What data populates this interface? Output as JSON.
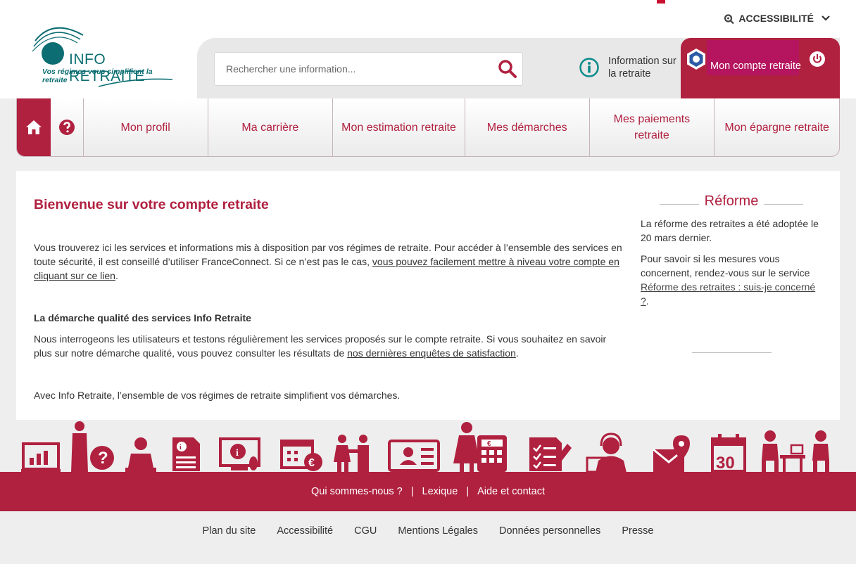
{
  "colors": {
    "brand_red": "#b0203f",
    "teal": "#0c6e72",
    "account_highlight": "#b4155e"
  },
  "header": {
    "accessibility_label": "ACCESSIBILITÉ",
    "logo_title": "INFO RETRAITE",
    "logo_tagline": "Vos régimes vous simplifient la retraite",
    "search_placeholder": "Rechercher une information...",
    "info_label": "Information sur la retraite",
    "account_label": "Mon compte retraite"
  },
  "nav": {
    "items": [
      {
        "label": "Mon profil"
      },
      {
        "label": "Ma carrière"
      },
      {
        "label": "Mon estimation retraite"
      },
      {
        "label": "Mes démarches"
      },
      {
        "label": "Mes paiements retraite"
      },
      {
        "label": "Mon épargne retraite"
      }
    ]
  },
  "main": {
    "title": "Bienvenue sur votre compte retraite",
    "intro_text": "Vous trouverez ici les services et informations mis à disposition par vos régimes de retraite. Pour accéder à l’ensemble des services en toute sécurité, il est conseillé d’utiliser FranceConnect. Si ce n’est pas le cas, ",
    "intro_link": "vous pouvez facilement mettre à niveau votre compte en cliquant sur ce lien",
    "intro_end": ".",
    "quality_title": "La démarche qualité des services Info Retraite",
    "quality_text": "Nous interrogeons les utilisateurs et testons régulièrement les services proposés sur le compte retraite. Si vous souhaitez en savoir plus sur notre démarche qualité, vous pouvez consulter les résultats de ",
    "quality_link": "nos dernières enquêtes de satisfaction",
    "quality_end": ".",
    "closing_text": "Avec Info Retraite, l’ensemble de vos régimes de retraite simplifient vos démarches."
  },
  "aside": {
    "title": "Réforme",
    "p1": "La réforme des retraites a été adoptée le 20 mars dernier.",
    "p2": "Pour savoir si les mesures vous concernent, rendez-vous sur le service ",
    "p2_link": "Réforme des retraites : suis-je concerné ?",
    "p2_end": "."
  },
  "illustrations": {
    "icons": [
      "chart-screen-icon",
      "thinking-person-icon",
      "desk-worker-icon",
      "info-document-icon",
      "info-computer-icon",
      "calendar-euro-icon",
      "handshake-icon",
      "id-card-icon",
      "person-calculator-icon",
      "checklist-icon",
      "support-agent-icon",
      "mail-location-icon",
      "calendar-30-icon",
      "meeting-desk-icon"
    ],
    "calendar_day": "30"
  },
  "footer": {
    "links": [
      {
        "label": "Qui sommes-nous ?"
      },
      {
        "label": "Lexique"
      },
      {
        "label": "Aide et contact"
      }
    ],
    "separator": "|"
  },
  "subfooter": {
    "links": [
      {
        "label": "Plan du site"
      },
      {
        "label": "Accessibilité"
      },
      {
        "label": "CGU"
      },
      {
        "label": "Mentions Légales"
      },
      {
        "label": "Données personnelles"
      },
      {
        "label": "Presse"
      }
    ]
  }
}
